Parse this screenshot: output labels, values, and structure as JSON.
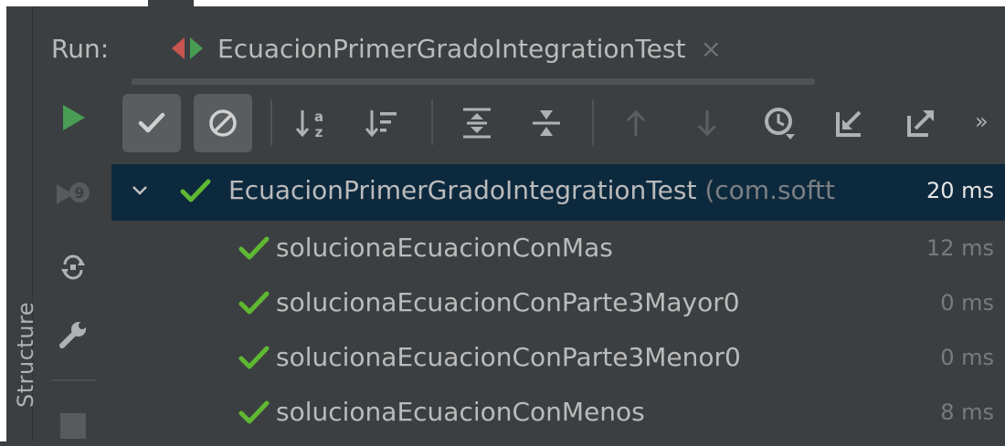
{
  "window": {
    "run_label": "Run:",
    "tab_label": "EcuacionPrimerGradoIntegrationTest",
    "tab_close": "×",
    "side_tool_window_label": "Structure"
  },
  "toolbar": {
    "buttons": [
      {
        "name": "show-passed-button",
        "icon": "check-icon",
        "toggled": true
      },
      {
        "name": "show-ignored-button",
        "icon": "ignored-icon",
        "toggled": true
      },
      {
        "name": "sort-alphabetically-button",
        "icon": "sort-alpha-icon",
        "toggled": false
      },
      {
        "name": "sort-by-duration-button",
        "icon": "sort-duration-icon",
        "toggled": false
      },
      {
        "name": "expand-all-button",
        "icon": "expand-all-icon",
        "toggled": false
      },
      {
        "name": "collapse-all-button",
        "icon": "collapse-all-icon",
        "toggled": false
      },
      {
        "name": "previous-failed-button",
        "icon": "arrow-up-icon",
        "toggled": false
      },
      {
        "name": "next-failed-button",
        "icon": "arrow-down-icon",
        "toggled": false
      },
      {
        "name": "test-history-button",
        "icon": "history-icon",
        "toggled": false
      },
      {
        "name": "import-tests-button",
        "icon": "import-icon",
        "toggled": false
      },
      {
        "name": "export-tests-button",
        "icon": "export-icon",
        "toggled": false
      }
    ],
    "more_label": "»"
  },
  "tree": {
    "root": {
      "name": "EcuacionPrimerGradoIntegrationTest",
      "package": "(com.softt",
      "time": "20 ms",
      "status": "passed"
    },
    "children": [
      {
        "name": "solucionaEcuacionConMas",
        "time": "12 ms",
        "status": "passed"
      },
      {
        "name": "solucionaEcuacionConParte3Mayor0",
        "time": "0 ms",
        "status": "passed"
      },
      {
        "name": "solucionaEcuacionConParte3Menor0",
        "time": "0 ms",
        "status": "passed"
      },
      {
        "name": "solucionaEcuacionConMenos",
        "time": "8 ms",
        "status": "passed"
      }
    ]
  },
  "colors": {
    "background": "#3c3f41",
    "selection": "#0d293e",
    "passed_green": "#5fb832",
    "run_green": "#499c54",
    "text": "#bbbbbb",
    "muted_text": "#787a7c"
  }
}
